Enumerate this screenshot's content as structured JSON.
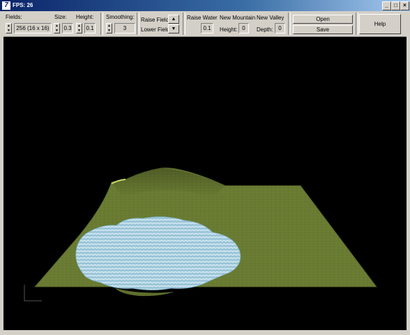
{
  "window": {
    "title": "FPS: 26",
    "icon": "app-logo-icon"
  },
  "titlebar_buttons": {
    "minimize": "_",
    "maximize": "□",
    "close": "×"
  },
  "toolbar": {
    "fields": {
      "label": "Fields:",
      "value": "256 (16 x 16)"
    },
    "size": {
      "label": "Size:",
      "value": "0.3"
    },
    "height": {
      "label": "Height:",
      "value": "0.1"
    },
    "smoothing": {
      "label": "Smoothing:",
      "value": "3"
    },
    "raise_field": "Raise Field",
    "lower_field": "Lower Field",
    "raise_water": {
      "label": "Raise Water",
      "value": "0.1"
    },
    "new_mountain": {
      "label": "New Mountain",
      "height_label": "Height:",
      "height_value": "0"
    },
    "new_valley": {
      "label": "New Valley",
      "depth_label": "Depth:",
      "depth_value": "0"
    },
    "open": "Open",
    "save": "Save",
    "help": "Help"
  },
  "scene": {
    "terrain_color": "#6b7d33",
    "water_color": "#a9cfe0",
    "background": "#000000"
  }
}
